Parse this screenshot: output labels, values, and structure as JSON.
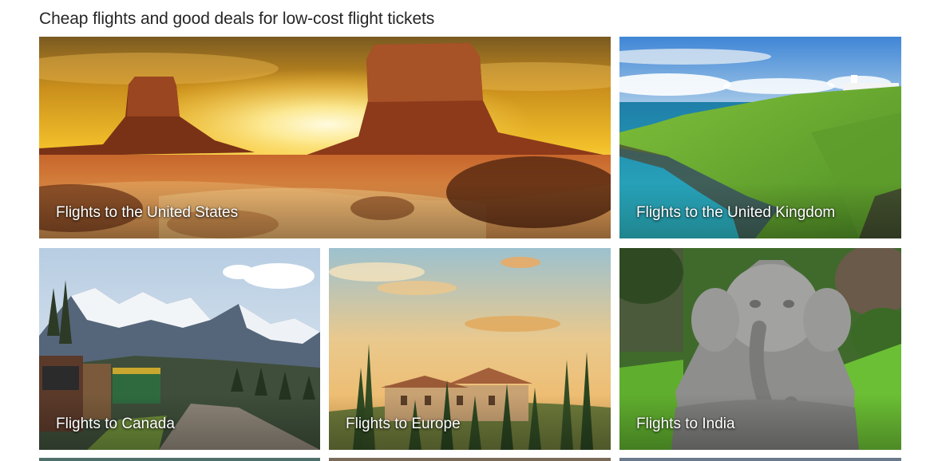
{
  "section": {
    "title": "Cheap flights and good deals for low-cost flight tickets"
  },
  "destinations": [
    {
      "label": "Flights to the United States",
      "scene": "desert-buttes-sunset"
    },
    {
      "label": "Flights to the United Kingdom",
      "scene": "coastal-cliffs-lighthouse"
    },
    {
      "label": "Flights to Canada",
      "scene": "mountain-train"
    },
    {
      "label": "Flights to Europe",
      "scene": "tuscan-villa-cypress"
    },
    {
      "label": "Flights to India",
      "scene": "ganesha-statue"
    }
  ],
  "colors": {
    "title_text": "#262626",
    "label_text": "#ffffff",
    "page_background": "#ffffff"
  }
}
